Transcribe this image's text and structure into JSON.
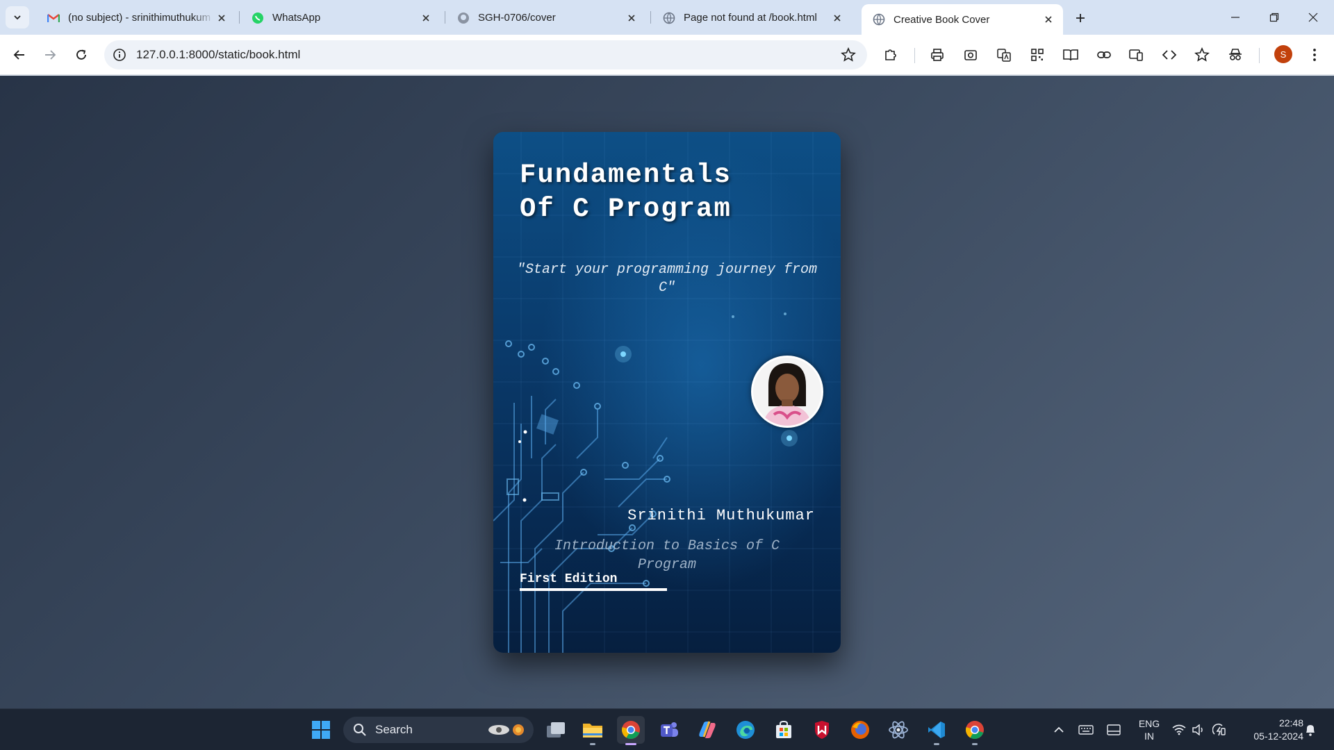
{
  "browser": {
    "tabs": [
      {
        "title": "(no subject) - srinithimuthukum",
        "icon": "gmail-icon"
      },
      {
        "title": "WhatsApp",
        "icon": "whatsapp-icon"
      },
      {
        "title": "SGH-0706/cover",
        "icon": "github-icon"
      },
      {
        "title": "Page not found at /book.html",
        "icon": "globe-icon"
      },
      {
        "title": "Creative Book Cover",
        "icon": "globe-icon",
        "active": true
      }
    ],
    "url": "127.0.0.1:8000/static/book.html",
    "profile_initial": "S",
    "profile_color": "#c2410c"
  },
  "book": {
    "title_line1": "Fundamentals",
    "title_line2": "Of C Program",
    "tagline": "\"Start your programming journey from C\"",
    "author": "Srinithi Muthukumar",
    "subtitle": "Introduction to Basics of C Program",
    "edition": "First Edition"
  },
  "taskbar": {
    "search_label": "Search",
    "apps": [
      "start-icon",
      "task-view-icon",
      "file-explorer-icon",
      "chrome-icon",
      "teams-icon",
      "copilot-icon",
      "edge-icon",
      "store-icon",
      "mcafee-icon",
      "firefox-icon",
      "atom-icon",
      "vscode-icon",
      "chrome-icon"
    ],
    "lang_line1": "ENG",
    "lang_line2": "IN",
    "time": "22:48",
    "date": "05-12-2024"
  },
  "colors": {
    "page_bg": "#3b4a5f",
    "book_bg": "#0a3b6c",
    "tabstrip": "#d6e2f3",
    "taskbar": "#1c2533"
  }
}
